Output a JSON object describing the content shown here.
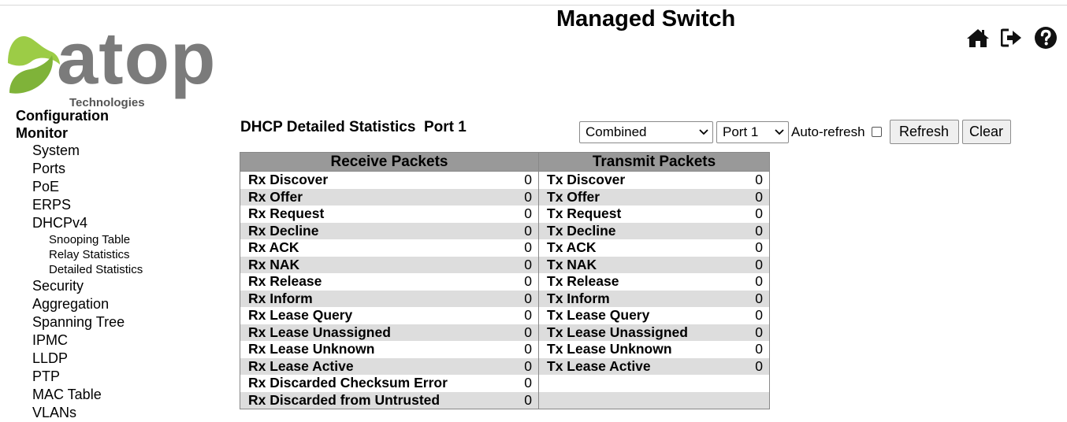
{
  "header": {
    "app_title": "Managed Switch",
    "logo_text": "atop",
    "logo_subtext": "Technologies",
    "icons": [
      "home-icon",
      "logout-icon",
      "help-icon"
    ]
  },
  "sidebar": {
    "configuration": "Configuration",
    "monitor": "Monitor",
    "items": [
      "System",
      "Ports",
      "PoE",
      "ERPS",
      "DHCPv4"
    ],
    "dhcp_sub": [
      "Snooping Table",
      "Relay Statistics",
      "Detailed Statistics"
    ],
    "items_after": [
      "Security",
      "Aggregation",
      "Spanning Tree",
      "IPMC",
      "LLDP",
      "PTP",
      "MAC Table",
      "VLANs"
    ]
  },
  "main": {
    "title": "DHCP Detailed Statistics  Port 1",
    "mode_select": "Combined",
    "port_select": "Port 1",
    "auto_refresh_label": "Auto-refresh",
    "auto_refresh_checked": false,
    "refresh_label": "Refresh",
    "clear_label": "Clear",
    "rx_header": "Receive Packets",
    "tx_header": "Transmit Packets",
    "rows": [
      {
        "rx_label": "Rx Discover",
        "rx_value": "0",
        "tx_label": "Tx Discover",
        "tx_value": "0"
      },
      {
        "rx_label": "Rx Offer",
        "rx_value": "0",
        "tx_label": "Tx Offer",
        "tx_value": "0"
      },
      {
        "rx_label": "Rx Request",
        "rx_value": "0",
        "tx_label": "Tx Request",
        "tx_value": "0"
      },
      {
        "rx_label": "Rx Decline",
        "rx_value": "0",
        "tx_label": "Tx Decline",
        "tx_value": "0"
      },
      {
        "rx_label": "Rx ACK",
        "rx_value": "0",
        "tx_label": "Tx ACK",
        "tx_value": "0"
      },
      {
        "rx_label": "Rx NAK",
        "rx_value": "0",
        "tx_label": "Tx NAK",
        "tx_value": "0"
      },
      {
        "rx_label": "Rx Release",
        "rx_value": "0",
        "tx_label": "Tx Release",
        "tx_value": "0"
      },
      {
        "rx_label": "Rx Inform",
        "rx_value": "0",
        "tx_label": "Tx Inform",
        "tx_value": "0"
      },
      {
        "rx_label": "Rx Lease Query",
        "rx_value": "0",
        "tx_label": "Tx Lease Query",
        "tx_value": "0"
      },
      {
        "rx_label": "Rx Lease Unassigned",
        "rx_value": "0",
        "tx_label": "Tx Lease Unassigned",
        "tx_value": "0"
      },
      {
        "rx_label": "Rx Lease Unknown",
        "rx_value": "0",
        "tx_label": "Tx Lease Unknown",
        "tx_value": "0"
      },
      {
        "rx_label": "Rx Lease Active",
        "rx_value": "0",
        "tx_label": "Tx Lease Active",
        "tx_value": "0"
      },
      {
        "rx_label": "Rx Discarded Checksum Error",
        "rx_value": "0",
        "tx_label": "",
        "tx_value": ""
      },
      {
        "rx_label": "Rx Discarded from Untrusted",
        "rx_value": "0",
        "tx_label": "",
        "tx_value": ""
      }
    ]
  },
  "colors": {
    "logo_green": "#8cc63f",
    "logo_gray": "#7b7b7b",
    "table_header": "#999999",
    "table_alt_row": "#dddddd"
  }
}
